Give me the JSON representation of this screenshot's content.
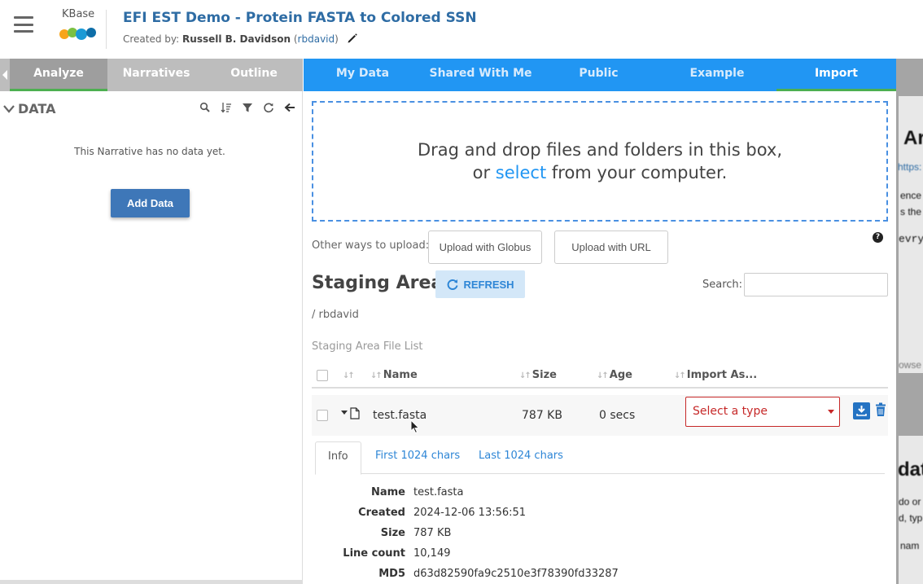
{
  "header": {
    "logo_text": "KBase",
    "title": "EFI EST Demo - Protein FASTA to Colored SSN",
    "created_by_label": "Created by:",
    "author_name": "Russell B. Davidson",
    "author_handle": "rbdavid"
  },
  "left_tabs": [
    "Analyze",
    "Narratives",
    "Outline"
  ],
  "data_panel": {
    "heading": "DATA",
    "empty_message": "This Narrative has no data yet.",
    "add_button": "Add Data"
  },
  "import_tabs": [
    "My Data",
    "Shared With Me",
    "Public",
    "Example",
    "Import"
  ],
  "upload": {
    "drop_line1": "Drag and drop files and folders in this box,",
    "drop_line2_pre": "or",
    "drop_line2_link": "select",
    "drop_line2_post": "from your computer.",
    "other_ways_label": "Other ways to upload:",
    "globus_button": "Upload with Globus",
    "url_button": "Upload with URL"
  },
  "staging": {
    "title": "Staging Area",
    "refresh_button": "REFRESH",
    "search_label": "Search:",
    "search_value": "",
    "path": "/ rbdavid",
    "list_label": "Staging Area File List",
    "columns": [
      "Name",
      "Size",
      "Age",
      "Import As..."
    ],
    "rows": [
      {
        "name": "test.fasta",
        "size": "787 KB",
        "age": "0 secs",
        "import_as": "Select a type"
      }
    ]
  },
  "detail_tabs": [
    "Info",
    "First 1024 chars",
    "Last 1024 chars"
  ],
  "file_info": [
    {
      "key": "Name",
      "value": "test.fasta"
    },
    {
      "key": "Created",
      "value": "2024-12-06 13:56:51"
    },
    {
      "key": "Size",
      "value": "787 KB"
    },
    {
      "key": "Line count",
      "value": "10,149"
    },
    {
      "key": "MD5",
      "value": "d63d82590fa9c2510e3f78390fd33287"
    }
  ],
  "background_fragments": [
    "Ar",
    "https:",
    "ence",
    "s the",
    "evry",
    "owse",
    "dat",
    "do or",
    "d, typ",
    "nam"
  ],
  "colors": {
    "primary_blue": "#2196f3",
    "tab_green": "#4caf50",
    "error_red": "#c62828",
    "link_blue": "#2e6ca4"
  }
}
